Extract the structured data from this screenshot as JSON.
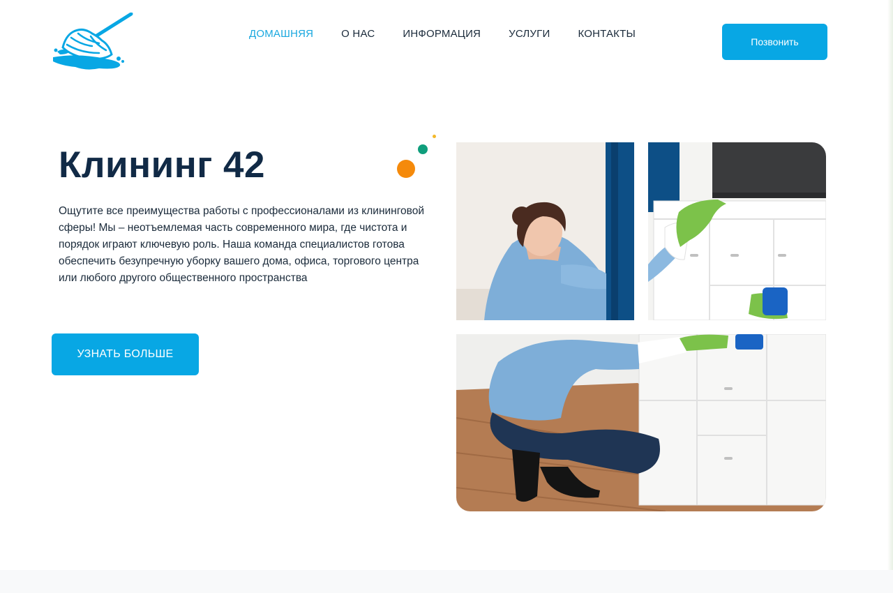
{
  "logo": {
    "icon": "mop-icon",
    "color": "#08a7e4"
  },
  "nav": {
    "items": [
      {
        "label": "ДОМАШНЯЯ",
        "active": true
      },
      {
        "label": "О НАС",
        "active": false
      },
      {
        "label": "ИНФОРМАЦИЯ",
        "active": false
      },
      {
        "label": "УСЛУГИ",
        "active": false
      },
      {
        "label": "КОНТАКТЫ",
        "active": false
      }
    ]
  },
  "header": {
    "call_label": "Позвонить"
  },
  "hero": {
    "title": "Клининг 42",
    "text": "Ощутите все преимущества работы с профессионалами из клининговой сферы! Мы – неотъемлемая часть современного мира, где чистота и порядок играют ключевую роль. Наша команда специалистов готова обеспечить безупречную уборку вашего дома, офиса, торгового центра или любого другого общественного пространства",
    "button_label": "УЗНАТЬ БОЛЬШЕ"
  },
  "decor": {
    "dot_colors": [
      "#f58a0b",
      "#0f9e7c",
      "#f3b82a"
    ]
  },
  "photos": [
    "woman-cleaning-cabinet-photo",
    "gloved-hands-wiping-photo",
    "woman-crouching-cleaning-photo"
  ],
  "colors": {
    "accent": "#08a7e4",
    "title": "#112a46",
    "text": "#1a2a3a"
  }
}
